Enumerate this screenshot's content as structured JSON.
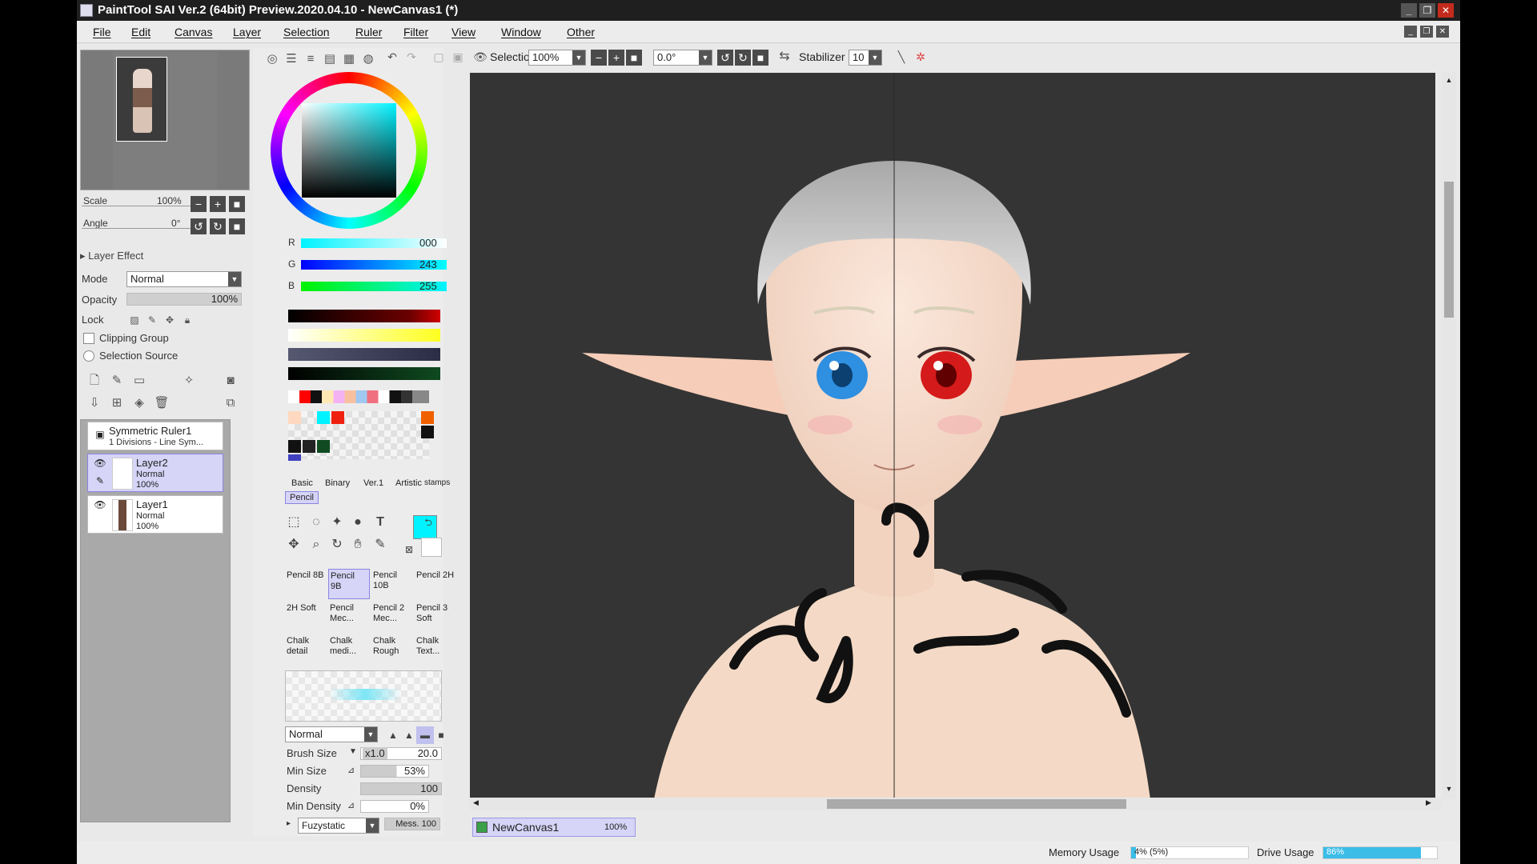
{
  "window": {
    "title": "PaintTool SAI Ver.2 (64bit) Preview.2020.04.10 - NewCanvas1 (*)",
    "controls": [
      "_",
      "❐",
      "✕"
    ]
  },
  "menu": [
    "File",
    "Edit",
    "Canvas",
    "Layer",
    "Selection",
    "Ruler",
    "Filter",
    "View",
    "Window",
    "Other"
  ],
  "navigator": {
    "scale_label": "Scale",
    "scale_value": "100%",
    "angle_label": "Angle",
    "angle_value": "0°"
  },
  "layer_props": {
    "layer_effect": "Layer Effect",
    "mode_label": "Mode",
    "mode_value": "Normal",
    "opacity_label": "Opacity",
    "opacity_value": "100%",
    "lock_label": "Lock",
    "clipping_group": "Clipping Group",
    "selection_source": "Selection Source"
  },
  "layers": [
    {
      "name": "Symmetric Ruler1",
      "sub": "1 Divisions - Line Sym...",
      "selected": false
    },
    {
      "name": "Layer2",
      "mode": "Normal",
      "opacity": "100%",
      "selected": true
    },
    {
      "name": "Layer1",
      "mode": "Normal",
      "opacity": "100%",
      "selected": false
    }
  ],
  "color": {
    "r_label": "R",
    "r_value": "000",
    "g_label": "G",
    "g_value": "243",
    "b_label": "B",
    "b_value": "255",
    "current": "#00f3ff"
  },
  "brush_tabs": [
    "Basic",
    "Binary",
    "Ver.1",
    "Artistic",
    "stamps"
  ],
  "brush_group": "Pencil",
  "brushes": [
    [
      "Pencil 8B",
      "Pencil 9B",
      "Pencil 10B",
      "Pencil 2H"
    ],
    [
      "2H Soft",
      "Pencil Mec...",
      "Pencil 2 Mec...",
      "Pencil 3 Soft"
    ],
    [
      "Chalk detail",
      "Chalk medi...",
      "Chalk Rough",
      "Chalk Text..."
    ]
  ],
  "brush_params": {
    "blend_mode": "Normal",
    "brush_size_label": "Brush Size",
    "brush_size_mult": "x1.0",
    "brush_size_value": "20.0",
    "min_size_label": "Min Size",
    "min_size_value": "53%",
    "density_label": "Density",
    "density_value": "100",
    "min_density_label": "Min Density",
    "min_density_value": "0%",
    "texture_label": "Fuzystatic",
    "texture_value": "Mess. 100"
  },
  "toolbar": {
    "selection_label": "Selection",
    "zoom_value": "100%",
    "rotate_value": "0.0°",
    "stabilizer_label": "Stabilizer",
    "stabilizer_value": "10"
  },
  "canvas_tab": {
    "name": "NewCanvas1",
    "zoom": "100%"
  },
  "status": {
    "memory_label": "Memory Usage",
    "memory_value": "4% (5%)",
    "memory_fraction": 0.04,
    "drive_label": "Drive Usage",
    "drive_value": "86%",
    "drive_fraction": 0.86
  }
}
